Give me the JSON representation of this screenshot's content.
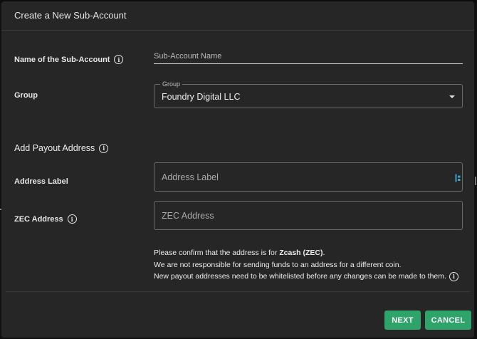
{
  "dialog": {
    "title": "Create a New Sub-Account"
  },
  "subaccount": {
    "label": "Name of the Sub-Account",
    "placeholder": "Sub-Account Name",
    "value": ""
  },
  "group": {
    "label": "Group",
    "floating_label": "Group",
    "selected": "Foundry Digital LLC"
  },
  "payout": {
    "section_title": "Add Payout Address",
    "address_label": {
      "label": "Address Label",
      "placeholder": "Address Label",
      "value": ""
    },
    "zec_address": {
      "label": "ZEC Address",
      "placeholder": "ZEC Address",
      "value": ""
    }
  },
  "notice": {
    "line1_prefix": "Please confirm that the address is for ",
    "line1_coin": "Zcash (ZEC)",
    "line1_suffix": ".",
    "line2": "We are not responsible for sending funds to an address for a different coin.",
    "line3": "New payout addresses need to be whitelisted before any changes can be made to them."
  },
  "actions": {
    "next_label": "NEXT",
    "cancel_label": "CANCEL"
  },
  "colors": {
    "dialog_bg": "#262626",
    "accent_button": "#2ea36a",
    "field_icon": "#3aa0c8"
  },
  "icons": {
    "info": "info-circle-icon",
    "dropdown": "chevron-down-icon",
    "password_manager": "password-manager-icon"
  }
}
